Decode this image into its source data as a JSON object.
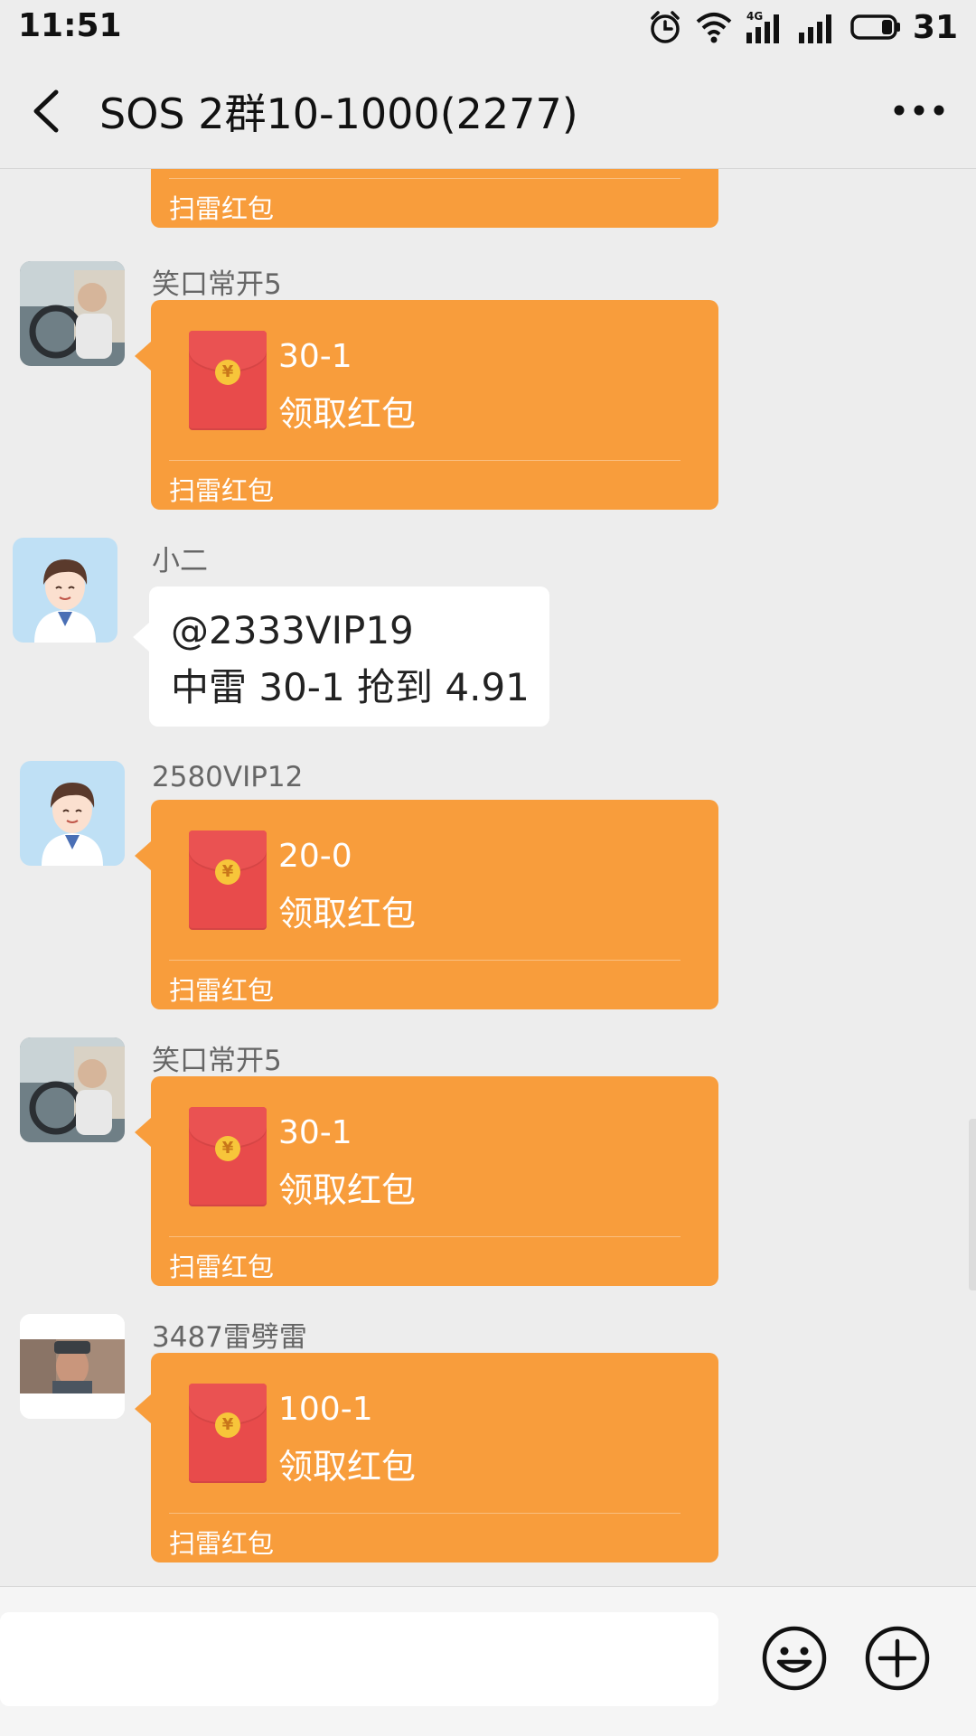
{
  "status_bar": {
    "time": "11:51",
    "battery_level": "31",
    "network_label": "4G",
    "icons": [
      "alarm-icon",
      "wifi-icon",
      "signal-4g-icon",
      "signal-icon",
      "battery-icon"
    ]
  },
  "header": {
    "title": "SOS 2群10-1000(2277)",
    "back_icon": "chevron-left-icon",
    "more_icon": "more-dots-icon"
  },
  "messages": [
    {
      "type": "red_packet_partial",
      "footer": "扫雷红包"
    },
    {
      "type": "red_packet",
      "sender": "笑口常开5",
      "amount": "30-1",
      "action": "领取红包",
      "footer": "扫雷红包"
    },
    {
      "type": "text",
      "sender": "小二",
      "lines": [
        "@2333VIP19",
        "中雷 30-1 抢到 4.91"
      ]
    },
    {
      "type": "red_packet",
      "sender": "2580VIP12",
      "amount": "20-0",
      "action": "领取红包",
      "footer": "扫雷红包"
    },
    {
      "type": "red_packet",
      "sender": "笑口常开5",
      "amount": "30-1",
      "action": "领取红包",
      "footer": "扫雷红包"
    },
    {
      "type": "red_packet",
      "sender": "3487雷劈雷",
      "amount": "100-1",
      "action": "领取红包",
      "footer": "扫雷红包"
    }
  ],
  "coin_symbol": "¥",
  "input_bar": {
    "placeholder": "",
    "emoji_icon": "smiley-icon",
    "plus_icon": "plus-circle-icon"
  },
  "colors": {
    "red_packet_bg": "#f89d3c",
    "envelope": "#e84b4b",
    "coin": "#f7c53a",
    "chat_bg": "#ededed"
  }
}
